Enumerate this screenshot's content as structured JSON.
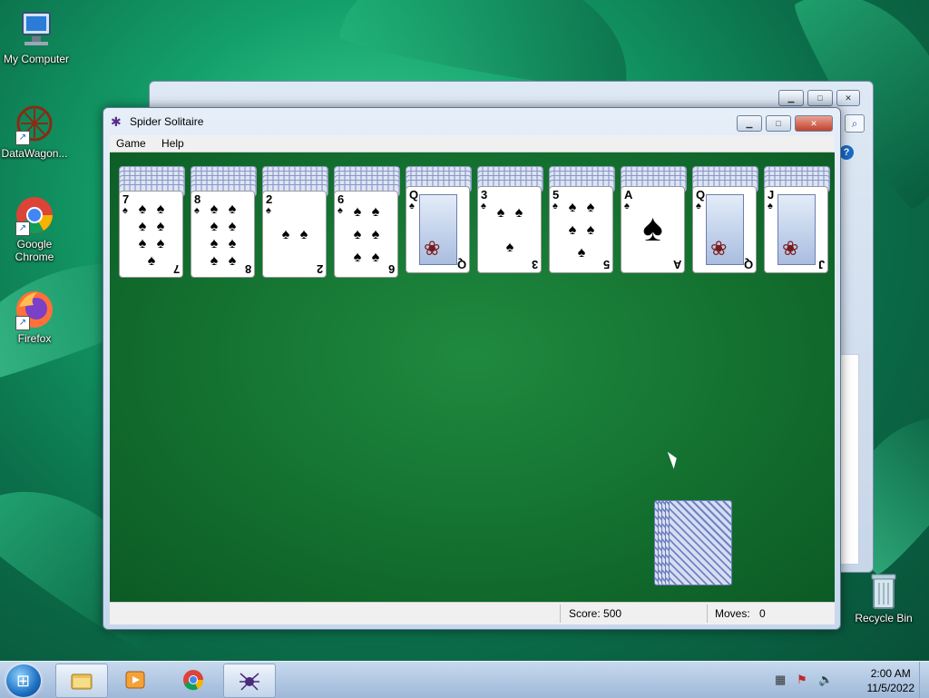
{
  "desktop": {
    "icons": [
      {
        "label": "My Computer"
      },
      {
        "label": "DataWagon..."
      },
      {
        "label": "Google Chrome"
      },
      {
        "label": "Firefox"
      },
      {
        "label": "Recycle Bin"
      }
    ]
  },
  "window": {
    "title": "Spider Solitaire",
    "menu": [
      "Game",
      "Help"
    ],
    "buttons": {
      "minimize": "▁",
      "maximize": "□",
      "close": "✕"
    }
  },
  "game": {
    "piles": [
      {
        "back_count": 5,
        "rank": "7",
        "suit": "♠",
        "face": false
      },
      {
        "back_count": 5,
        "rank": "8",
        "suit": "♠",
        "face": false
      },
      {
        "back_count": 5,
        "rank": "2",
        "suit": "♠",
        "face": false
      },
      {
        "back_count": 5,
        "rank": "6",
        "suit": "♠",
        "face": false
      },
      {
        "back_count": 4,
        "rank": "Q",
        "suit": "♠",
        "face": true
      },
      {
        "back_count": 4,
        "rank": "3",
        "suit": "♠",
        "face": false
      },
      {
        "back_count": 4,
        "rank": "5",
        "suit": "♠",
        "face": false
      },
      {
        "back_count": 4,
        "rank": "A",
        "suit": "♠",
        "face": false
      },
      {
        "back_count": 4,
        "rank": "Q",
        "suit": "♠",
        "face": true
      },
      {
        "back_count": 4,
        "rank": "J",
        "suit": "♠",
        "face": true
      }
    ],
    "stock_count": 5
  },
  "status": {
    "score_label": "Score: 500",
    "moves_label": "Moves:",
    "moves_value": "0"
  },
  "taskbar": {
    "time": "2:00 AM",
    "date": "11/5/2022"
  },
  "colors": {
    "felt": "#13702f",
    "taskbar": "#9fb8d8"
  }
}
